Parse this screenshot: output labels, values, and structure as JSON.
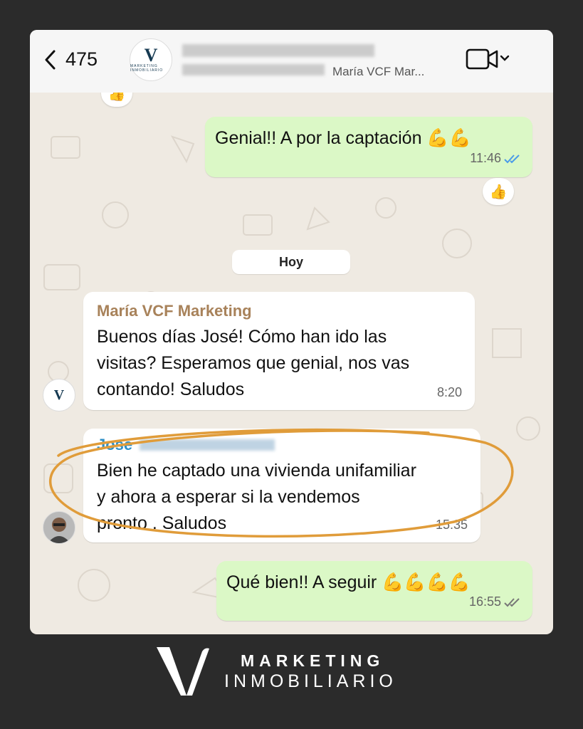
{
  "header": {
    "back_count": "475",
    "avatar_letter": "V",
    "avatar_caption": "MARKETING INMOBILIARIO",
    "subtitle": "María VCF Mar..."
  },
  "messages": [
    {
      "text": "Genial!! A por la captación",
      "emoji": "💪💪",
      "time": "11:46",
      "reaction": "👍",
      "ticks": "read"
    },
    {
      "day_label": "Hoy"
    },
    {
      "sender": "María VCF Marketing",
      "lines": [
        "Buenos días José! Cómo han ido las",
        "visitas? Esperamos que genial, nos vas",
        "contando! Saludos"
      ],
      "time": "8:20"
    },
    {
      "sender": "Jose",
      "lines": [
        "Bien he captado una vivienda unifamiliar",
        "y ahora a esperar si la vendemos",
        "pronto . Saludos"
      ],
      "time": "15:35"
    },
    {
      "text": "Qué bien!! A seguir",
      "emoji": "💪💪💪💪",
      "time": "16:55",
      "ticks": "delivered"
    }
  ],
  "colors": {
    "outgoing_bubble": "#dbf8c6",
    "incoming_bubble": "#ffffff",
    "chat_background": "#efeae2",
    "sender1": "#a8825a",
    "sender2": "#2d8fc7",
    "highlight_circle": "#e09c3a",
    "read_tick": "#4a9be8"
  },
  "footer": {
    "logo_letter": "V",
    "brand_line1": "MARKETING",
    "brand_line2": "INMOBILIARIO"
  }
}
